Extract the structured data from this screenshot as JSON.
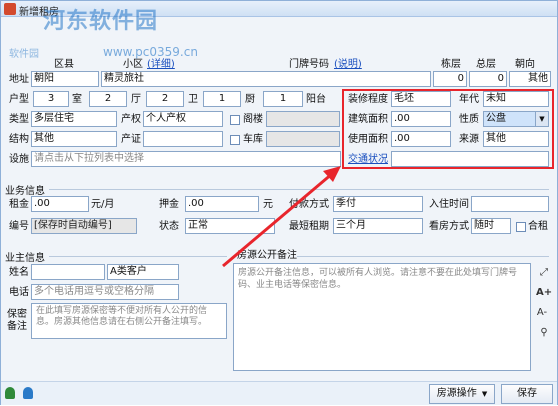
{
  "window": {
    "title": "新增租房"
  },
  "watermark": {
    "brand": "河东软件园",
    "url": "www.pc0359.cn",
    "sub": "软件园"
  },
  "header": {
    "district_label": "区县",
    "xiaoqu_label": "小区",
    "xiaoqu_link": "(详细)",
    "door_label": "门牌号码",
    "door_link": "(说明)",
    "building_label": "栋层",
    "total_floor_label": "总层",
    "orientation_label": "朝向"
  },
  "address": {
    "label": "地址",
    "district": "朝阳",
    "xiaoqu": "精灵旅社",
    "floor": "0",
    "total_floor": "0",
    "orientation": "其他"
  },
  "layout_row": {
    "label": "户型",
    "rooms": "3",
    "room_unit": "室",
    "halls": "2",
    "hall_unit": "厅",
    "baths": "2",
    "bath_unit": "卫",
    "kitchens": "1",
    "kitchen_unit": "厨",
    "balcony": "1",
    "balcony_unit": "阳台"
  },
  "type_row": {
    "label": "类型",
    "value": "多层住宅",
    "right_label": "产权",
    "right_value": "个人产权",
    "check_label": "阁楼"
  },
  "structure_row": {
    "label": "结构",
    "value": "其他",
    "right_label": "产证",
    "right_value": "",
    "check_label": "车库"
  },
  "facilities": {
    "label": "设施",
    "placeholder": "请点击从下拉列表中选择"
  },
  "highlight": {
    "decor_label": "装修程度",
    "decor_value": "毛坯",
    "year_label": "年代",
    "year_value": "未知",
    "area_label": "建筑面积",
    "area_value": ".00",
    "nature_label": "性质",
    "nature_value": "公盘",
    "usable_label": "使用面积",
    "usable_value": ".00",
    "source_label": "来源",
    "source_value": "其他",
    "traffic_link": "交通状况"
  },
  "business": {
    "group_label": "业务信息",
    "rent_label": "租金",
    "rent_value": ".00",
    "rent_unit": "元/月",
    "deposit_label": "押金",
    "deposit_value": ".00",
    "deposit_unit": "元",
    "pay_label": "付款方式",
    "pay_value": "季付",
    "checkin_label": "入住时间",
    "checkin_value": "",
    "code_label": "编号",
    "code_value": "[保存时自动编号]",
    "status_label": "状态",
    "status_value": "正常",
    "min_term_label": "最短租期",
    "min_term_value": "三个月",
    "viewing_label": "看房方式",
    "viewing_value": "随时",
    "shared_label": "合租"
  },
  "owner": {
    "group_label": "业主信息",
    "name_label": "姓名",
    "name_value": "",
    "type_value": "A类客户",
    "phone_label": "电话",
    "phone_placeholder": "多个电话用逗号或空格分隔",
    "secret_label": "保密备注",
    "secret_placeholder": "在此填写房源保密等不便对所有人公开的信息。房源其他信息请在右侧公开备注填写。"
  },
  "public_note": {
    "label": "房源公开备注",
    "placeholder": "房源公开备注信息，可以被所有人浏览。请注意不要在此处填写门牌号码、业主电话等保密信息。"
  },
  "side_icons": {
    "expand": "⤢",
    "font_up": "A+",
    "font_down": "A-",
    "tag": "⚲"
  },
  "bottom": {
    "ops_label": "房源操作",
    "ops_arrow": "▼",
    "save_label": "保存"
  }
}
